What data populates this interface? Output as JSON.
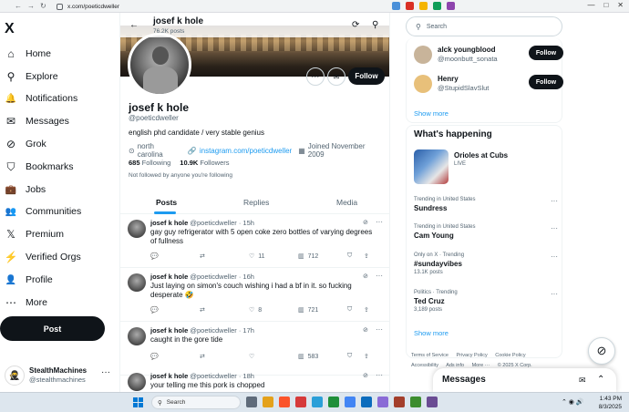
{
  "browser": {
    "url": "x.com/poeticdweller"
  },
  "sidebar": {
    "logo": "X",
    "items": [
      {
        "label": "Home",
        "icon": "⌂"
      },
      {
        "label": "Explore",
        "icon": "⚲"
      },
      {
        "label": "Notifications",
        "icon": "🔔"
      },
      {
        "label": "Messages",
        "icon": "✉"
      },
      {
        "label": "Grok",
        "icon": "⊘"
      },
      {
        "label": "Bookmarks",
        "icon": "⛉"
      },
      {
        "label": "Jobs",
        "icon": "💼"
      },
      {
        "label": "Communities",
        "icon": "👥"
      },
      {
        "label": "Premium",
        "icon": "𝕏"
      },
      {
        "label": "Verified Orgs",
        "icon": "⚡"
      },
      {
        "label": "Profile",
        "icon": "👤"
      },
      {
        "label": "More",
        "icon": "⋯"
      }
    ],
    "post_label": "Post",
    "me": {
      "name": "StealthMachines",
      "handle": "@stealthmachines",
      "more": "···"
    }
  },
  "topbar": {
    "name": "josef k hole",
    "count": "76.2K posts",
    "back": "←"
  },
  "profile": {
    "name": "josef k hole",
    "handle": "@poeticdweller",
    "bio": "english phd candidate / very stable genius",
    "location": "north carolina",
    "link": "instagram.com/poeticdweller",
    "joined": "Joined November 2009",
    "following_count": "685",
    "following_label": "Following",
    "followers_count": "10.9K",
    "followers_label": "Followers",
    "not_followed": "Not followed by anyone you're following",
    "follow_label": "Follow",
    "more": "···"
  },
  "tabs": [
    "Posts",
    "Replies",
    "Media"
  ],
  "tweets": [
    {
      "name": "josef k hole",
      "handle": "@poeticdweller",
      "time": "· 15h",
      "text": "gay guy refrigerator with 5 open coke zero bottles of varying degrees of fullness",
      "likes": "11",
      "views": "712"
    },
    {
      "name": "josef k hole",
      "handle": "@poeticdweller",
      "time": "· 16h",
      "text": "Just laying on simon's couch wishing i had a bf in it. so fucking desperate 🤣",
      "likes": "8",
      "views": "721"
    },
    {
      "name": "josef k hole",
      "handle": "@poeticdweller",
      "time": "· 17h",
      "text": "caught in the gore tide",
      "likes": "",
      "views": "583"
    },
    {
      "name": "josef k hole",
      "handle": "@poeticdweller",
      "time": "· 18h",
      "text": "your telling me this pork is chopped",
      "likes": "",
      "views": ""
    }
  ],
  "right": {
    "search_placeholder": "Search",
    "who_to_follow": [
      {
        "name": "alck youngblood",
        "handle": "@moonbutt_sonata",
        "button": "Follow"
      },
      {
        "name": "Henry",
        "handle": "@StupidSlavSlut",
        "button": "Follow"
      }
    ],
    "show_more": "Show more",
    "happening_title": "What's happening",
    "live": {
      "title": "Orioles at Cubs",
      "label": "LIVE"
    },
    "trends": [
      {
        "context": "Trending in United States",
        "name": "Sundress",
        "count": ""
      },
      {
        "context": "Trending in United States",
        "name": "Cam Young",
        "count": ""
      },
      {
        "context": "Only on X · Trending",
        "name": "#sundayvibes",
        "count": "13.1K posts"
      },
      {
        "context": "Politics · Trending",
        "name": "Ted Cruz",
        "count": "3,189 posts"
      }
    ],
    "show_more2": "Show more",
    "footer": [
      "Terms of Service",
      "Privacy Policy",
      "Cookie Policy",
      "Accessibility",
      "Ads info",
      "More ···",
      "© 2025 X Corp."
    ],
    "messages_label": "Messages"
  },
  "taskbar": {
    "search": "Search",
    "time": "1:43 PM",
    "date": "8/3/2025"
  },
  "colors": {
    "accent": "#1d9bf0",
    "text": "#0f1419",
    "muted": "#536471"
  }
}
